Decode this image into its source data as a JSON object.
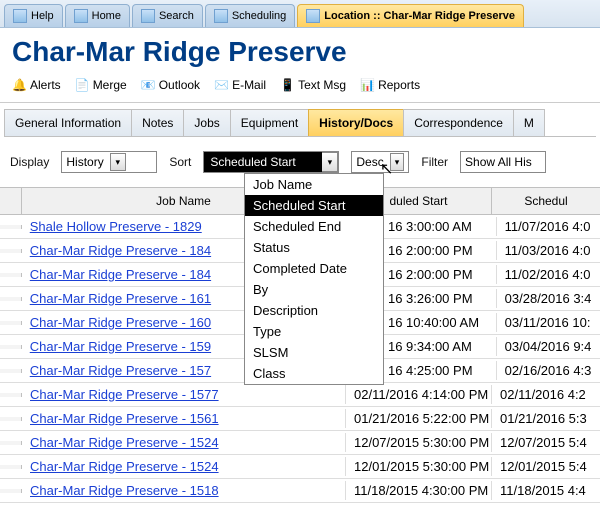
{
  "appTabs": [
    {
      "label": "Help"
    },
    {
      "label": "Home"
    },
    {
      "label": "Search"
    },
    {
      "label": "Scheduling"
    },
    {
      "label": "Location :: Char-Mar Ridge Preserve",
      "active": true
    }
  ],
  "pageTitle": "Char-Mar Ridge Preserve",
  "toolbar": {
    "alerts": "Alerts",
    "merge": "Merge",
    "outlook": "Outlook",
    "email": "E-Mail",
    "text": "Text Msg",
    "reports": "Reports"
  },
  "sectionTabs": {
    "general": "General Information",
    "notes": "Notes",
    "jobs": "Jobs",
    "equipment": "Equipment",
    "history": "History/Docs",
    "correspondence": "Correspondence",
    "more": "M"
  },
  "filters": {
    "displayLabel": "Display",
    "displayValue": "History",
    "sortLabel": "Sort",
    "sortFieldValue": "Scheduled Start",
    "sortDirValue": "Desc",
    "filterLabel": "Filter",
    "filterValue": "Show All His"
  },
  "sortOptions": [
    "Job Name",
    "Scheduled Start",
    "Scheduled End",
    "Status",
    "Completed Date",
    "By",
    "Description",
    "Type",
    "SLSM",
    "Class"
  ],
  "selectedSortOption": "Scheduled Start",
  "columns": {
    "name": "Job Name",
    "start": "duled Start",
    "end": "Schedul"
  },
  "rows": [
    {
      "name": "Shale Hollow Preserve - 1829",
      "start": "16 3:00:00 AM",
      "end": "11/07/2016 4:0"
    },
    {
      "name": "Char-Mar Ridge Preserve - 184",
      "start": "16 2:00:00 PM",
      "end": "11/03/2016 4:0"
    },
    {
      "name": "Char-Mar Ridge Preserve - 184",
      "start": "16 2:00:00 PM",
      "end": "11/02/2016 4:0"
    },
    {
      "name": "Char-Mar Ridge Preserve - 161",
      "start": "16 3:26:00 PM",
      "end": "03/28/2016 3:4"
    },
    {
      "name": "Char-Mar Ridge Preserve - 160",
      "start": "16 10:40:00 AM",
      "end": "03/11/2016 10:"
    },
    {
      "name": "Char-Mar Ridge Preserve - 159",
      "start": "16 9:34:00 AM",
      "end": "03/04/2016 9:4"
    },
    {
      "name": "Char-Mar Ridge Preserve - 157",
      "start": "16 4:25:00 PM",
      "end": "02/16/2016 4:3"
    },
    {
      "name": "Char-Mar Ridge Preserve - 1577",
      "start": "02/11/2016 4:14:00 PM",
      "end": "02/11/2016 4:2"
    },
    {
      "name": "Char-Mar Ridge Preserve - 1561",
      "start": "01/21/2016 5:22:00 PM",
      "end": "01/21/2016 5:3"
    },
    {
      "name": "Char-Mar Ridge Preserve - 1524",
      "start": "12/07/2015 5:30:00 PM",
      "end": "12/07/2015 5:4"
    },
    {
      "name": "Char-Mar Ridge Preserve - 1524",
      "start": "12/01/2015 5:30:00 PM",
      "end": "12/01/2015 5:4"
    },
    {
      "name": "Char-Mar Ridge Preserve - 1518",
      "start": "11/18/2015 4:30:00 PM",
      "end": "11/18/2015 4:4"
    }
  ]
}
